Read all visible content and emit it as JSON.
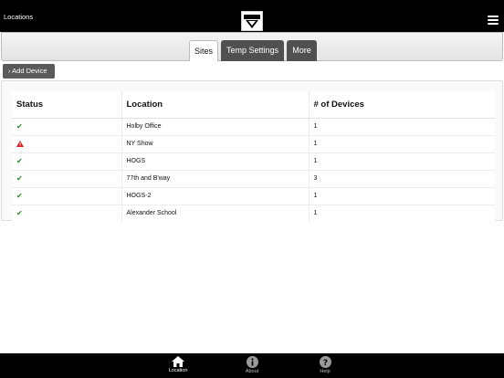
{
  "header": {
    "title": "Locations",
    "logo": "HOLBY",
    "menu_icon": "hamburger-menu-icon"
  },
  "tabs": [
    {
      "label": "Sites",
      "active": true
    },
    {
      "label": "Temp Settings",
      "active": false
    },
    {
      "label": "More",
      "active": false
    }
  ],
  "add_device": "› Add Device",
  "table": {
    "headers": [
      "Status",
      "Location",
      "# of Devices"
    ],
    "rows": [
      {
        "status": "ok",
        "status_icon": "checkmark-icon",
        "location": "Holby Office",
        "devices": "1"
      },
      {
        "status": "warning",
        "status_icon": "warning-icon",
        "location": "NY Show",
        "devices": "1"
      },
      {
        "status": "ok",
        "status_icon": "checkmark-icon",
        "location": "HOGS",
        "devices": "1"
      },
      {
        "status": "ok",
        "status_icon": "checkmark-icon",
        "location": "77th and B'way",
        "devices": "3"
      },
      {
        "status": "ok",
        "status_icon": "checkmark-icon",
        "location": "HOGS-2",
        "devices": "1"
      },
      {
        "status": "ok",
        "status_icon": "checkmark-icon",
        "location": "Alexander School",
        "devices": "1"
      }
    ]
  },
  "bottom_nav": [
    {
      "label": "Location",
      "icon": "home-icon",
      "active": true
    },
    {
      "label": "About",
      "icon": "info-icon",
      "active": false
    },
    {
      "label": "Help",
      "icon": "help-icon",
      "active": false
    }
  ],
  "colors": {
    "ok": "#1e8a1e",
    "warning": "#d62020",
    "bar": "#000000",
    "dark_tab": "#505050"
  }
}
